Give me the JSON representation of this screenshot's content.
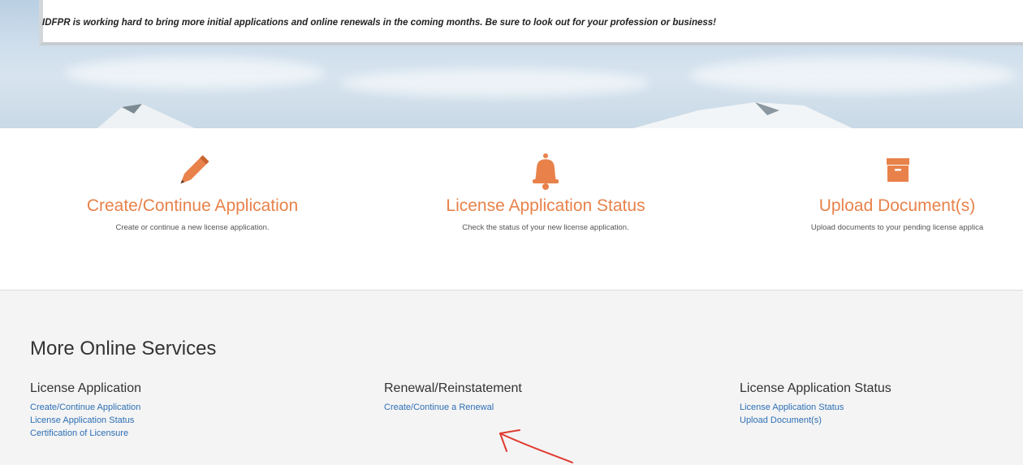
{
  "notice": {
    "text": "IDFPR is working hard to bring more initial applications and online renewals in the coming months. Be sure to look out for your profession or business!"
  },
  "services": [
    {
      "icon": "pencil-icon",
      "title": "Create/Continue Application",
      "description": "Create or continue a new license application."
    },
    {
      "icon": "bell-icon",
      "title": "License Application Status",
      "description": "Check the status of your new license application."
    },
    {
      "icon": "archive-box-icon",
      "title": "Upload Document(s)",
      "description": "Upload documents to your pending license applica"
    }
  ],
  "more_services": {
    "title": "More Online Services",
    "columns": [
      {
        "heading": "License Application",
        "links": [
          "Create/Continue Application",
          "License Application Status",
          "Certification of Licensure"
        ]
      },
      {
        "heading": "Renewal/Reinstatement",
        "links": [
          "Create/Continue a Renewal"
        ]
      },
      {
        "heading": "License Application Status",
        "links": [
          "License Application Status",
          "Upload Document(s)"
        ]
      }
    ]
  },
  "colors": {
    "accent_orange": "#e8824a",
    "link_blue": "#2d6fb5",
    "annotation_red": "#e03a2f"
  }
}
